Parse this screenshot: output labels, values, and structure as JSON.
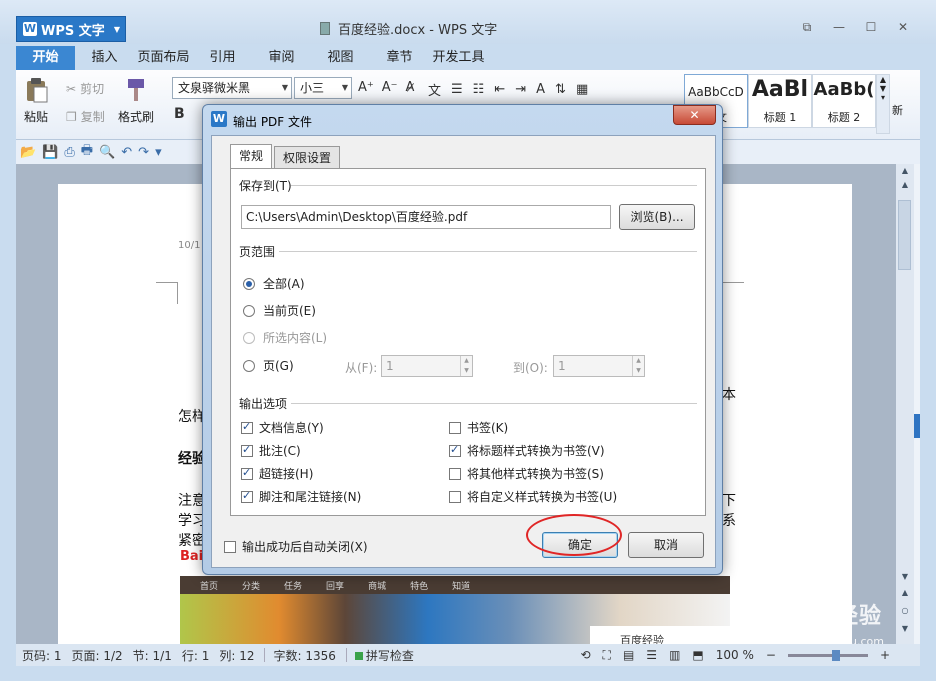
{
  "app": {
    "menu_label": "WPS 文字",
    "window_title": "百度经验.docx - WPS 文字"
  },
  "tabs": [
    "开始",
    "插入",
    "页面布局",
    "引用",
    "审阅",
    "视图",
    "章节",
    "开发工具"
  ],
  "ribbon": {
    "paste": "粘贴",
    "cut": "剪切",
    "copy": "复制",
    "format_painter": "格式刷",
    "font_name": "文泉驿微米黑",
    "font_size": "小三",
    "bold": "B",
    "styles": [
      {
        "sample": "AaBbCcD",
        "name": "正文"
      },
      {
        "sample": "AaBl",
        "name": "标题 1"
      },
      {
        "sample": "AaBb(",
        "name": "标题 2"
      }
    ],
    "new_style": "新"
  },
  "document": {
    "header_date": "10/1",
    "frag_1": "怎样",
    "frag_2": "经验",
    "frag_3": "注意",
    "frag_4": "学习",
    "frag_5": "紧密",
    "frag_right_1": "本",
    "frag_right_2": "下",
    "frag_right_3": "系",
    "baidu_logo": "Bai",
    "image_nav": [
      "首页",
      "分类",
      "任务",
      "回享",
      "商城",
      "特色",
      "知道"
    ],
    "image_badge": "百度经验"
  },
  "status": {
    "page_code": "页码: 1",
    "pages": "页面: 1/2",
    "section": "节: 1/1",
    "row": "行: 1",
    "col": "列: 12",
    "word_count": "字数: 1356",
    "spellcheck": "拼写检查",
    "zoom": "100 %"
  },
  "watermark": {
    "text": "Bai 经验",
    "url": "jingyan.baidu.com"
  },
  "dialog": {
    "title": "输出 PDF 文件",
    "close": "✕",
    "tabs": [
      "常规",
      "权限设置"
    ],
    "save_to_label": "保存到(T)",
    "save_path": "C:\\Users\\Admin\\Desktop\\百度经验.pdf",
    "browse": "浏览(B)...",
    "page_range_label": "页范围",
    "range_options": [
      {
        "label": "全部(A)",
        "checked": true,
        "disabled": false
      },
      {
        "label": "当前页(E)",
        "checked": false,
        "disabled": false
      },
      {
        "label": "所选内容(L)",
        "checked": false,
        "disabled": true
      },
      {
        "label": "页(G)",
        "checked": false,
        "disabled": false
      }
    ],
    "from_label": "从(F):",
    "from_value": "1",
    "to_label": "到(O):",
    "to_value": "1",
    "output_label": "输出选项",
    "output_left": [
      {
        "label": "文档信息(Y)",
        "checked": true
      },
      {
        "label": "批注(C)",
        "checked": true
      },
      {
        "label": "超链接(H)",
        "checked": true
      },
      {
        "label": "脚注和尾注链接(N)",
        "checked": true
      }
    ],
    "output_right": [
      {
        "label": "书签(K)",
        "checked": false
      },
      {
        "label": "将标题样式转换为书签(V)",
        "checked": true
      },
      {
        "label": "将其他样式转换为书签(S)",
        "checked": false
      },
      {
        "label": "将自定义样式转换为书签(U)",
        "checked": false
      }
    ],
    "auto_close": "输出成功后自动关闭(X)",
    "ok": "确定",
    "cancel": "取消"
  }
}
